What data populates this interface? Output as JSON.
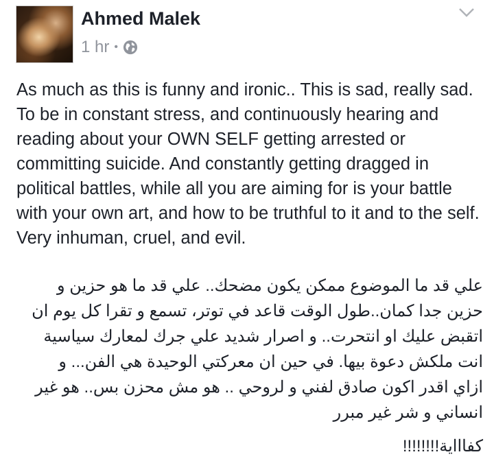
{
  "post": {
    "author": "Ahmed Malek",
    "time": "1 hr",
    "separator": "•",
    "audience_icon": "globe-icon",
    "menu_icon": "chevron-down-icon",
    "english_text": "As much as this is funny and ironic.. This is sad, really sad. To be in constant stress, and continuously hearing and reading about your OWN SELF  getting arrested or committing suicide. And constantly getting dragged in political battles, while all you are aiming for is your battle with your own art, and how to be truthful to it and to the self. Very inhuman, cruel, and evil.",
    "arabic_lines": [
      "علي قد ما الموضوع ممكن يكون مضحك.. علي قد ما هو حزين و",
      "حزين جدا كمان..طول الوقت قاعد في توتر، تسمع و تقرا كل يوم ان",
      "اتقبض عليك او انتحرت.. و اصرار شديد علي جرك لمعارك سياسية",
      "انت ملكش دعوة بيها. في حين ان معركتي الوحيدة هي الفن... و",
      "ازاي اقدر اكون صادق لفني و لروحي .. هو مش محزن بس.. هو غير",
      "انساني و شر غير مبرر"
    ],
    "arabic_closing": "كفاااية!!!!!!!!"
  },
  "colors": {
    "text": "#1d2129",
    "meta": "#90949c"
  }
}
